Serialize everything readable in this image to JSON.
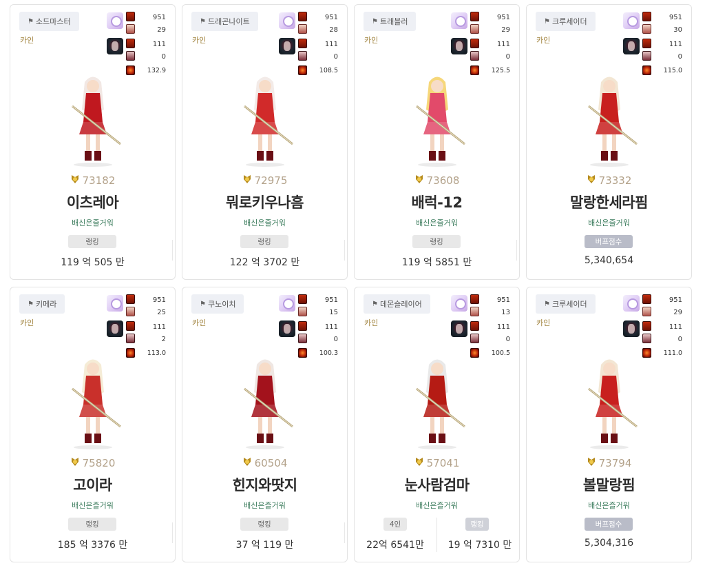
{
  "cards": [
    {
      "job": "소드마스터",
      "server": "카인",
      "stats": [
        "951",
        "29",
        "111",
        "0",
        "132.9"
      ],
      "fame": "73182",
      "name": "이츠레아",
      "guild": "배신은즐거워",
      "badge": "랭킹",
      "badge_type": "rank",
      "score": "119 억 505 만",
      "outfit": "#c0181f",
      "hair": "#f2e8e4"
    },
    {
      "job": "드래곤나이트",
      "server": "카인",
      "stats": [
        "951",
        "28",
        "111",
        "0",
        "108.5"
      ],
      "fame": "72975",
      "name": "뭐로키우나흠",
      "guild": "배신은즐거워",
      "badge": "랭킹",
      "badge_type": "rank",
      "score": "122 억 3702 만",
      "outfit": "#d12a2a",
      "hair": "#f3ebe8"
    },
    {
      "job": "트래블러",
      "server": "카인",
      "stats": [
        "951",
        "29",
        "111",
        "0",
        "125.5"
      ],
      "fame": "73608",
      "name": "배럭-12",
      "guild": "배신은즐거워",
      "badge": "랭킹",
      "badge_type": "rank",
      "score": "119 억 5851 만",
      "outfit": "#e24a6a",
      "hair": "#f6d77a"
    },
    {
      "job": "크루세이더",
      "server": "카인",
      "stats": [
        "951",
        "30",
        "111",
        "0",
        "115.0"
      ],
      "fame": "73332",
      "name": "말랑한세라핌",
      "guild": "배신은즐거워",
      "badge": "버프점수",
      "badge_type": "buff",
      "score": "5,340,654",
      "outfit": "#c8201e",
      "hair": "#f3e6d3"
    },
    {
      "job": "키메라",
      "server": "카인",
      "stats": [
        "951",
        "25",
        "111",
        "2",
        "113.0"
      ],
      "fame": "75820",
      "name": "고이라",
      "guild": "배신은즐거워",
      "badge": "랭킹",
      "badge_type": "rank",
      "score": "185 억 3376 만",
      "outfit": "#c9302b",
      "hair": "#f5ecd6"
    },
    {
      "job": "쿠노이치",
      "server": "카인",
      "stats": [
        "951",
        "15",
        "111",
        "0",
        "100.3"
      ],
      "fame": "60504",
      "name": "힌지와땃지",
      "guild": "배신은즐거워",
      "badge": "랭킹",
      "badge_type": "rank",
      "score": "37 억 119 만",
      "outfit": "#a3121c",
      "hair": "#efe7e3"
    },
    {
      "job": "데몬슬레이어",
      "server": "카인",
      "stats": [
        "951",
        "13",
        "111",
        "0",
        "100.5"
      ],
      "fame": "57041",
      "name": "눈사람검마",
      "guild": "배신은즐거워",
      "split": [
        {
          "badge": "4인",
          "score": "22억 6541만"
        },
        {
          "badge": "랭킹",
          "score": "19 억 7310 만"
        }
      ],
      "outfit": "#b51b14",
      "hair": "#e9e9e9"
    },
    {
      "job": "크루세이더",
      "server": "카인",
      "stats": [
        "951",
        "29",
        "111",
        "0",
        "111.0"
      ],
      "fame": "73794",
      "name": "볼말랑핌",
      "guild": "배신은즐거워",
      "badge": "버프점수",
      "badge_type": "buff",
      "score": "5,304,316",
      "outfit": "#c8201e",
      "hair": "#f3e6d3"
    }
  ]
}
